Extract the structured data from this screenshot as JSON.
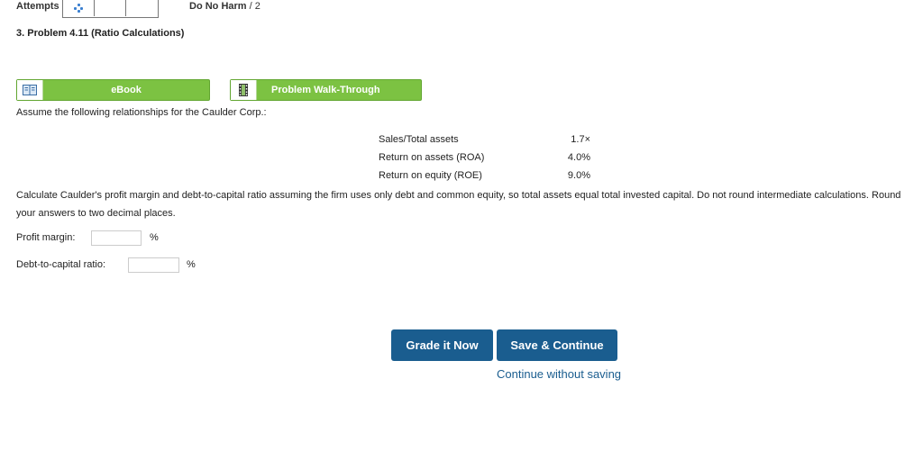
{
  "header": {
    "attempts_label": "Attempts",
    "harm_label": "Do No Harm",
    "harm_score": "/ 2"
  },
  "problem": {
    "title": "3.  Problem 4.11 (Ratio Calculations)"
  },
  "buttons": {
    "ebook_label": "eBook",
    "walkthrough_label": "Problem Walk-Through"
  },
  "content": {
    "intro": "Assume the following relationships for the Caulder Corp.:",
    "relationships": [
      {
        "name": "Sales/Total assets",
        "value": "1.7×"
      },
      {
        "name": "Return on assets (ROA)",
        "value": "4.0%"
      },
      {
        "name": "Return on equity (ROE)",
        "value": "9.0%"
      }
    ],
    "instructions": "Calculate Caulder's profit margin and debt-to-capital ratio assuming the firm uses only debt and common equity, so total assets equal total invested capital. Do not round intermediate calculations. Round your answers to two decimal places."
  },
  "answers": {
    "profit_margin_label": "Profit margin:",
    "profit_margin_value": "",
    "profit_margin_unit": "%",
    "debt_ratio_label": "Debt-to-capital ratio:",
    "debt_ratio_value": "",
    "debt_ratio_unit": "%"
  },
  "actions": {
    "grade_label": "Grade it Now",
    "save_label": "Save & Continue",
    "continue_label": "Continue without saving"
  },
  "colors": {
    "green_button": "#7cc242",
    "blue_button": "#1a5d8f"
  }
}
